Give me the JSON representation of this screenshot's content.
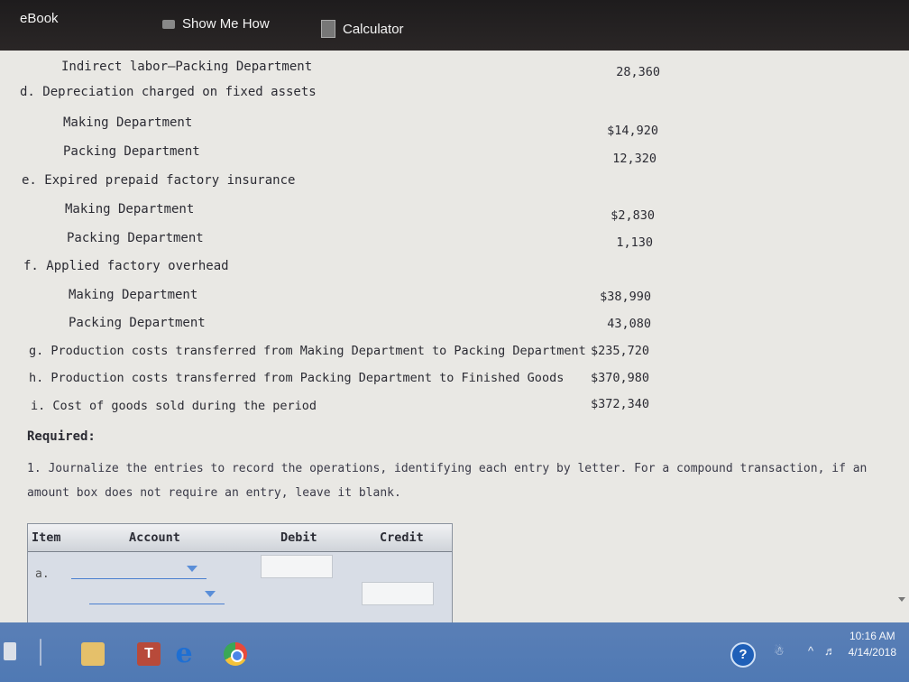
{
  "toolbar": {
    "ebook": "eBook",
    "show_me_how": "Show Me How",
    "calculator": "Calculator"
  },
  "lines": [
    {
      "label": "Indirect labor—Packing Department",
      "amount": "28,360"
    },
    {
      "label": "d. Depreciation charged on fixed assets",
      "amount": ""
    },
    {
      "label": "Making Department",
      "amount": "$14,920"
    },
    {
      "label": "Packing Department",
      "amount": "12,320"
    },
    {
      "label": "e. Expired prepaid factory insurance",
      "amount": ""
    },
    {
      "label": "Making Department",
      "amount": "$2,830"
    },
    {
      "label": "Packing Department",
      "amount": "1,130"
    },
    {
      "label": "f. Applied factory overhead",
      "amount": ""
    },
    {
      "label": "Making Department",
      "amount": "$38,990"
    },
    {
      "label": "Packing Department",
      "amount": "43,080"
    },
    {
      "label": "g. Production costs transferred from Making Department to Packing Department",
      "amount": "$235,720"
    },
    {
      "label": "h. Production costs transferred from Packing Department to Finished Goods",
      "amount": "$370,980"
    },
    {
      "label": "i. Cost of goods sold during the period",
      "amount": "$372,340"
    }
  ],
  "required_label": "Required:",
  "instruction": "1. Journalize the entries to record the operations, identifying each entry by letter. For a compound transaction, if an amount box does not require an entry, leave it blank.",
  "journal": {
    "headers": {
      "item": "Item",
      "account": "Account",
      "debit": "Debit",
      "credit": "Credit"
    },
    "row_label": "a."
  },
  "taskbar": {
    "help_icon": "?",
    "t_app": "T",
    "e_app": "e",
    "clock_time": "10:16 AM",
    "clock_date": "4/14/2018"
  },
  "colors": {
    "toolbar_bg": "#211e1f",
    "taskbar_bg": "#5078b4",
    "page_bg": "#e9e8e4",
    "dropdown_accent": "#4a7fcf"
  }
}
